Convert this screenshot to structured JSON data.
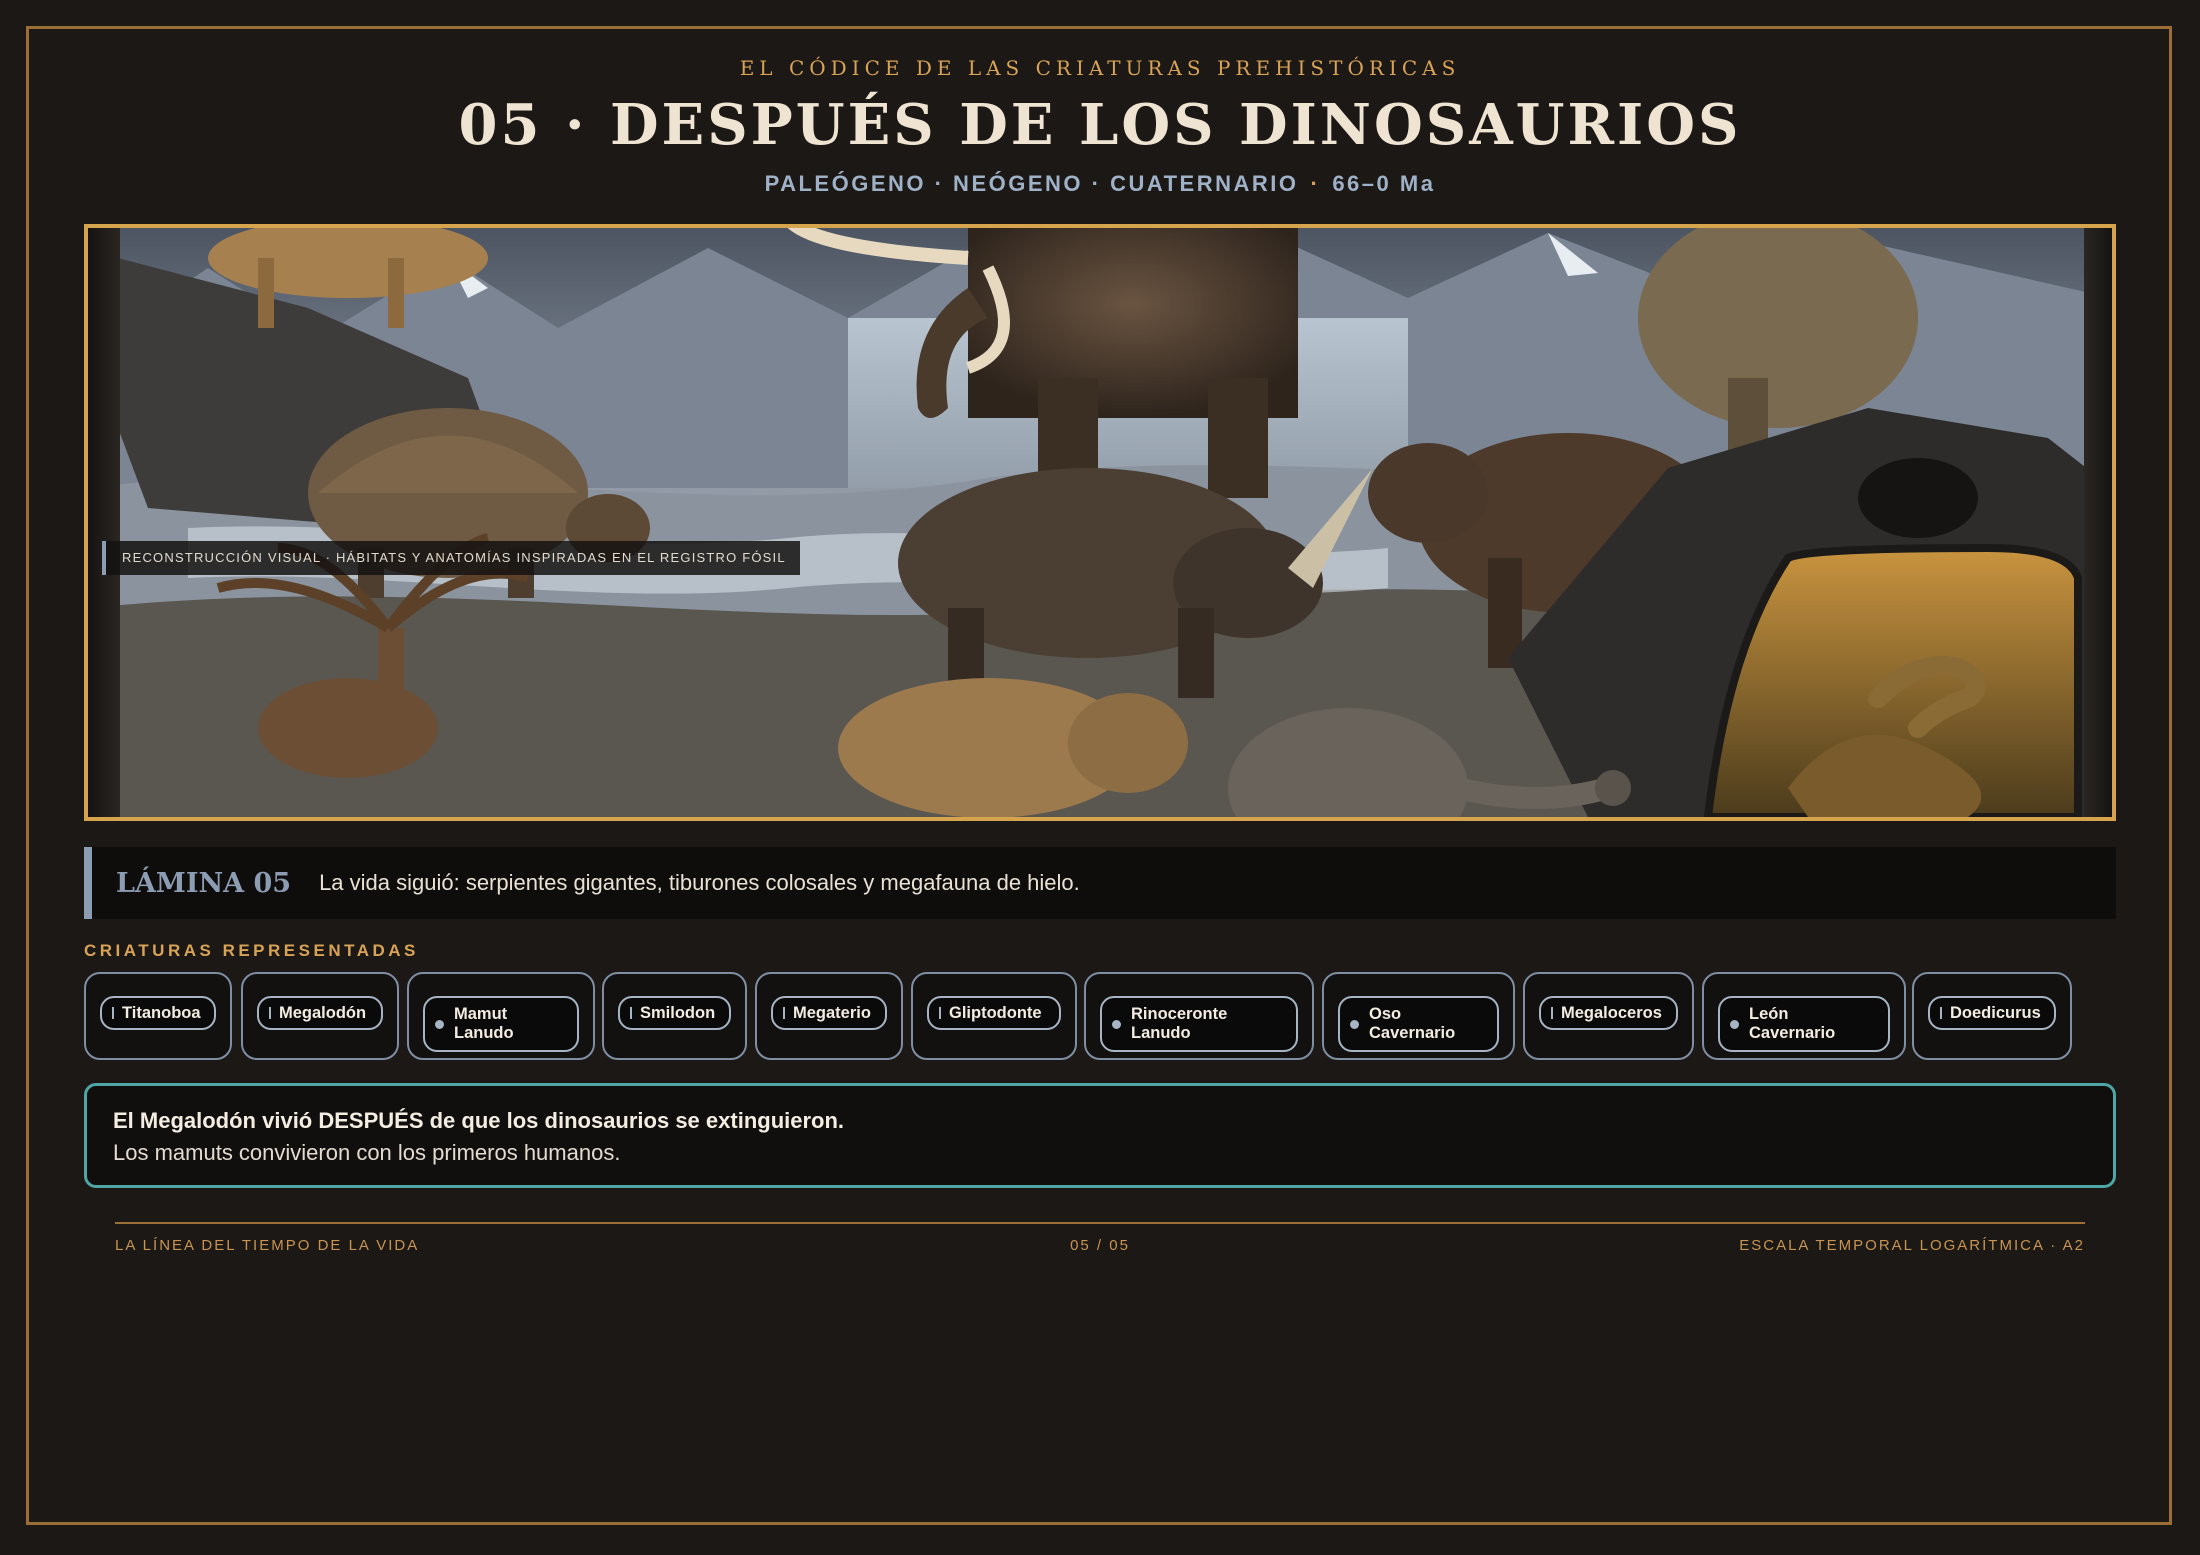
{
  "header": {
    "series": "EL CÓDICE DE LAS CRIATURAS PREHISTÓRICAS",
    "title": "05 · DESPUÉS DE LOS DINOSAURIOS",
    "periods": "PALEÓGENO · NEÓGENO · CUATERNARIO",
    "separator": "·",
    "age": "66–0 Ma"
  },
  "illustration": {
    "caption": "RECONSTRUCCIÓN VISUAL · HÁBITATS Y ANATOMÍAS INSPIRADAS EN EL REGISTRO FÓSIL",
    "depicted": [
      "smilodon",
      "woolly-mammoth",
      "glyptodon",
      "woolly-rhino",
      "cave-bear",
      "megaloceros",
      "cave-lion",
      "doedicurus",
      "titanoboa",
      "megatherium"
    ]
  },
  "lamina": {
    "number": "LÁMINA 05",
    "text": "La vida siguió: serpientes gigantes, tiburones colosales y megafauna de hielo."
  },
  "creatures": {
    "label": "CRIATURAS REPRESENTADAS",
    "items": [
      {
        "name": "Titanoboa",
        "marker": "bar"
      },
      {
        "name": "Megalodón",
        "marker": "bar"
      },
      {
        "name": "Mamut\nLanudo",
        "marker": "dot"
      },
      {
        "name": "Smilodon",
        "marker": "bar"
      },
      {
        "name": "Megaterio",
        "marker": "bar"
      },
      {
        "name": "Gliptodonte",
        "marker": "bar"
      },
      {
        "name": "Rinoceronte\nLanudo",
        "marker": "dot"
      },
      {
        "name": "Oso\nCavernario",
        "marker": "dot"
      },
      {
        "name": "Megaloceros",
        "marker": "bar"
      },
      {
        "name": "León\nCavernario",
        "marker": "dot"
      },
      {
        "name": "Doedicurus",
        "marker": "bar"
      }
    ]
  },
  "facts": {
    "line1": "El Megalodón vivió DESPUÉS de que los dinosaurios se extinguieron.",
    "line2": "Los mamuts convivieron con los primeros humanos."
  },
  "footer": {
    "left": "LA LÍNEA DEL TIEMPO DE LA VIDA",
    "center": "05 / 05",
    "right": "ESCALA TEMPORAL LOGARÍTMICA · A2"
  },
  "colors": {
    "background": "#1b1816",
    "gold": "#d9a356",
    "frame": "#9a6e34",
    "steel": "#8c9cb2",
    "teal": "#4fa6a6"
  }
}
